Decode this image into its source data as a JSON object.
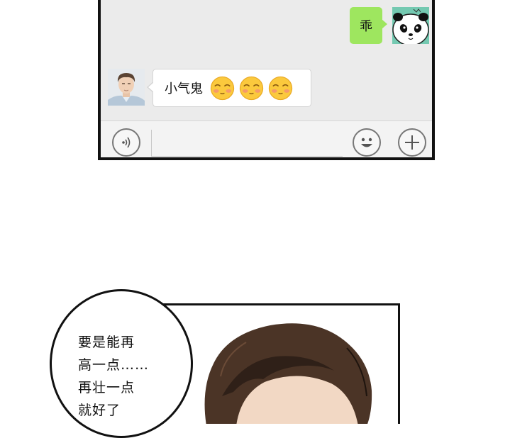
{
  "chat": {
    "outgoing_message": "乖",
    "incoming_message": "小气鬼",
    "incoming_emoji": [
      "blush-emoji",
      "blush-emoji",
      "blush-emoji"
    ],
    "icons": {
      "voice": "voice-icon",
      "emoji": "smiley-icon",
      "plus": "plus-icon"
    },
    "colors": {
      "outgoing_bubble": "#9ee65f",
      "panda_avatar_bg": "#74c9b1",
      "chat_background": "#ebebeb"
    }
  },
  "comic": {
    "speech_lines": [
      "要是能再",
      "高一点……",
      "再壮一点",
      "就好了"
    ]
  }
}
